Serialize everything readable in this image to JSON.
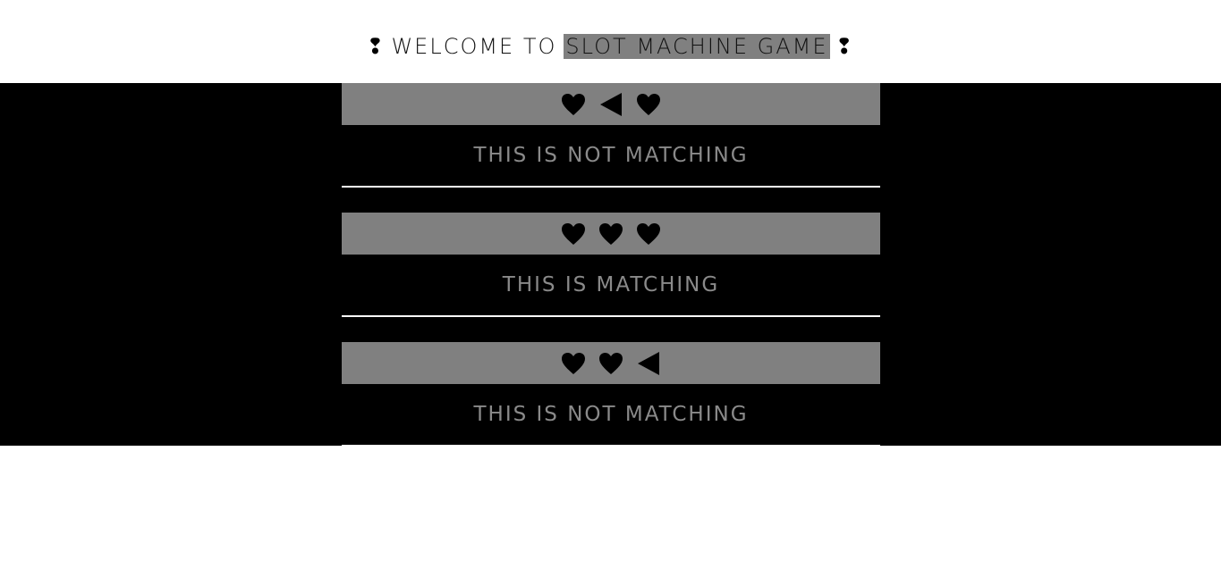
{
  "header": {
    "prefix_mark": "❢",
    "title_plain": "WELCOME TO",
    "title_highlight": "SLOT MACHINE GAME ",
    "suffix_mark": "❢"
  },
  "rows": [
    {
      "symbols": [
        "heart-icon",
        "triangle-left-icon",
        "heart-icon"
      ],
      "result": "THIS IS NOT MATCHING"
    },
    {
      "symbols": [
        "heart-icon",
        "heart-icon",
        "heart-icon"
      ],
      "result": "THIS IS MATCHING"
    },
    {
      "symbols": [
        "heart-icon",
        "heart-icon",
        "triangle-left-icon"
      ],
      "result": "THIS IS NOT MATCHING"
    }
  ],
  "colors": {
    "band": "#000000",
    "reel_background": "#808080",
    "result_text": "#8a8a8a",
    "divider": "#ffffff"
  }
}
